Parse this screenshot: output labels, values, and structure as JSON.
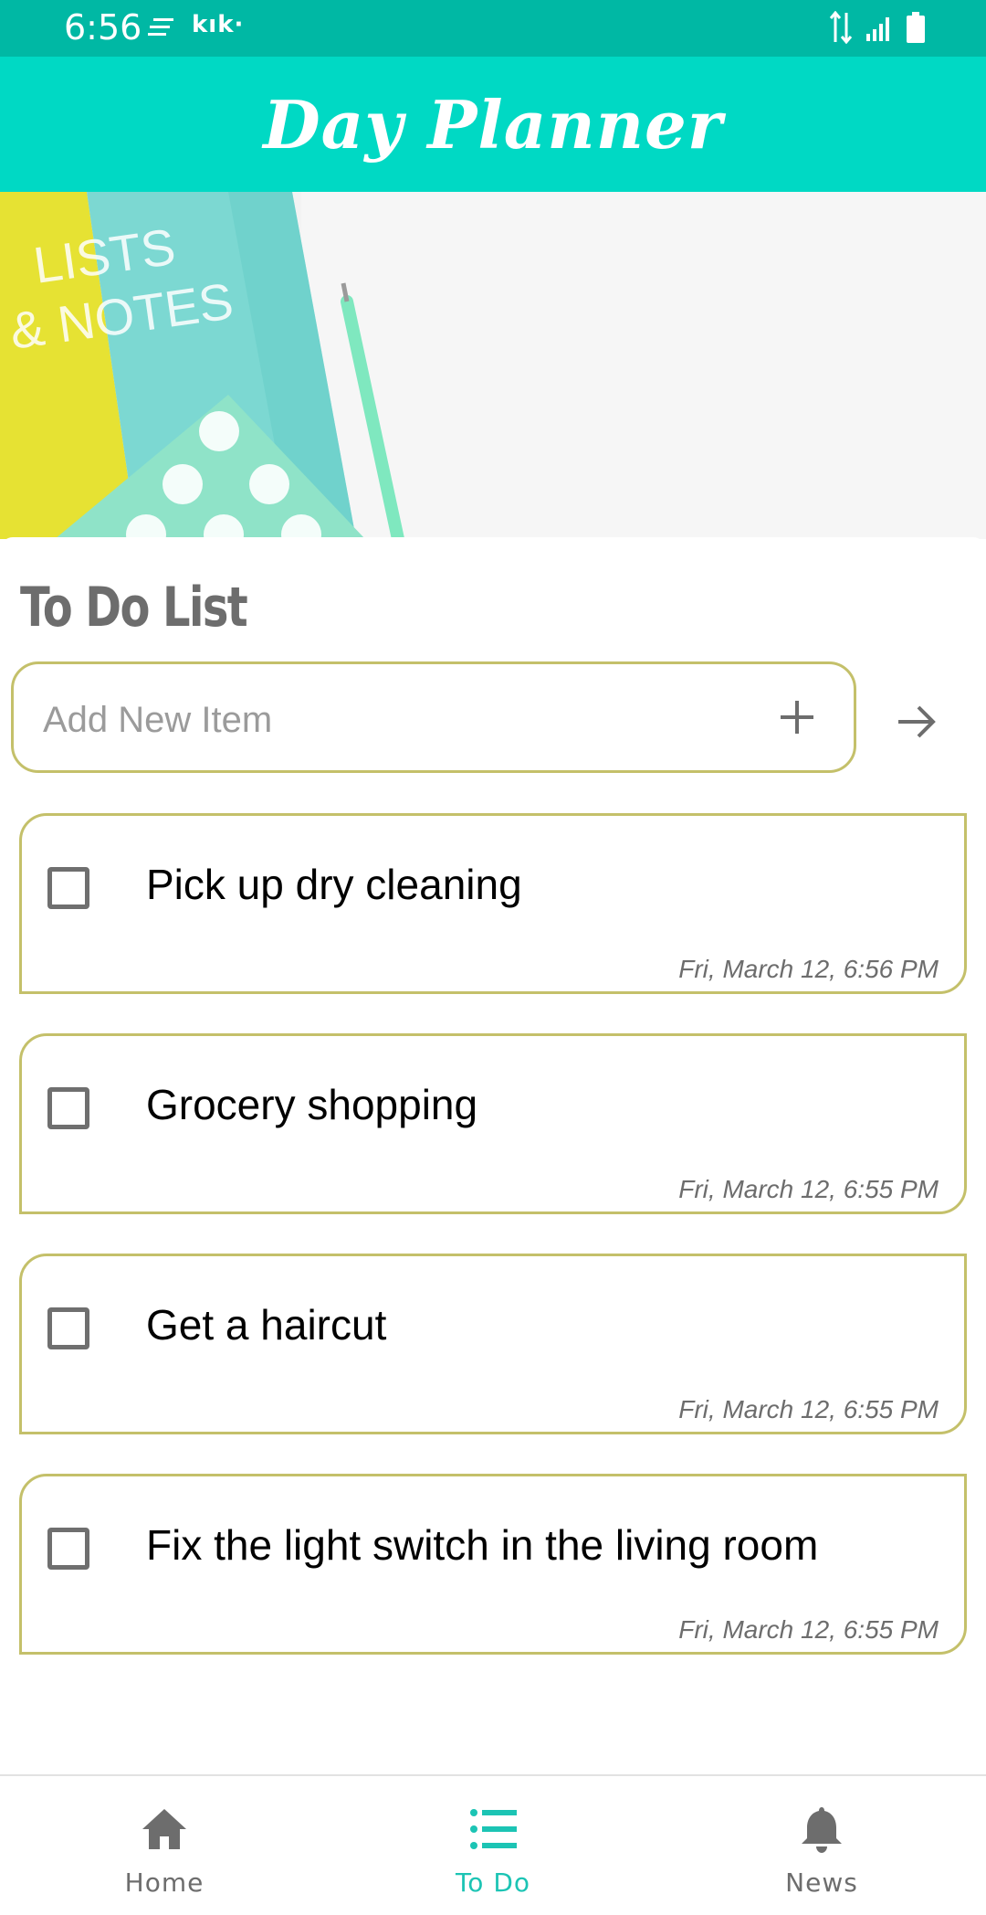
{
  "status_bar": {
    "time": "6:56",
    "app_notification": "kık·"
  },
  "header": {
    "title": "Day Planner"
  },
  "banner": {
    "text_line1": "LISTS",
    "text_line2": "& NOTES"
  },
  "todo": {
    "title": "To Do List",
    "add_placeholder": "Add New Item",
    "items": [
      {
        "text": "Pick up dry cleaning",
        "time": "Fri, March 12, 6:56 PM"
      },
      {
        "text": "Grocery shopping",
        "time": "Fri, March 12, 6:55 PM"
      },
      {
        "text": "Get a haircut",
        "time": "Fri, March 12, 6:55 PM"
      },
      {
        "text": "Fix the light switch in the living room",
        "time": "Fri, March 12, 6:55 PM"
      }
    ]
  },
  "nav": {
    "items": [
      {
        "label": "Home",
        "icon": "home-icon",
        "active": false
      },
      {
        "label": "To Do",
        "icon": "list-icon",
        "active": true
      },
      {
        "label": "News",
        "icon": "bell-icon",
        "active": false
      }
    ]
  },
  "colors": {
    "status_bar": "#00b8a4",
    "header": "#00d9c4",
    "accent": "#1cc4b4",
    "item_border": "#c4c06a",
    "nav_inactive": "#6d6d6d"
  }
}
